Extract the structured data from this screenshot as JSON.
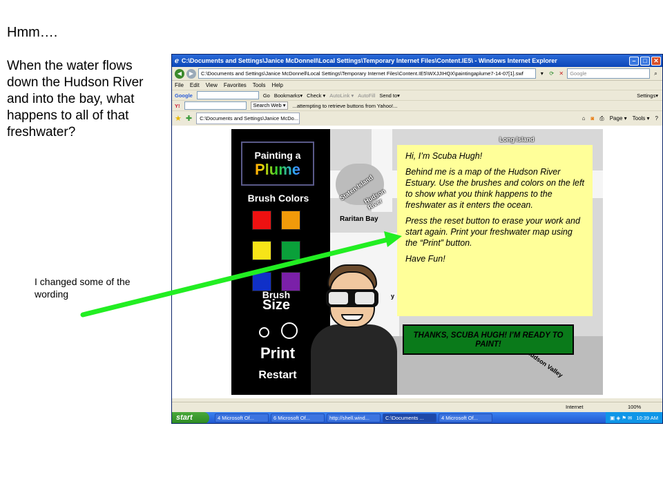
{
  "slide": {
    "title": "Hmm….",
    "question": "When the water flows down the Hudson River and into the bay, what happens to all of that freshwater?",
    "note": "I changed some of the wording"
  },
  "browser": {
    "title": "C:\\Documents and Settings\\Janice McDonnell\\Local Settings\\Temporary Internet Files\\Content.IE5\\ - Windows Internet Explorer",
    "address": "C:\\Documents and Settings\\Janice McDonnell\\Local Settings\\Temporary Internet Files\\Content.IE5\\WXJJIHQX\\paintingaplume7-14-07[1].swf",
    "search_placeholder": "Google",
    "menu": [
      "File",
      "Edit",
      "View",
      "Favorites",
      "Tools",
      "Help"
    ],
    "google_toolbar": {
      "logo": "Google",
      "go": "Go",
      "bookmarks": "Bookmarks▾",
      "check": "Check ▾",
      "autolink": "AutoLink ▾",
      "autofill": "AutoFill",
      "sendto": "Send to▾",
      "settings": "Settings▾"
    },
    "yahoo_toolbar": {
      "logo": "Y!",
      "search_web": "Search Web ▾",
      "status": "...attempting to retrieve buttons from Yahoo!..."
    },
    "tab_label": "C:\\Documents and Settings\\Janice McDo...",
    "tab_tools": {
      "page": "Page ▾",
      "tools": "Tools ▾"
    },
    "status": {
      "zone": "Internet",
      "zoom": "100%"
    }
  },
  "game": {
    "logo_top": "Painting a",
    "logo_bottom": "Plume",
    "brush_colors_label": "Brush Colors",
    "swatches": [
      "#ee1111",
      "#f09a0a",
      "#f7e418",
      "#0aa03a",
      "#1030c8",
      "#7a20a8"
    ],
    "brush_label": "Brush",
    "size_label": "Size",
    "print_label": "Print",
    "restart_label": "Restart",
    "map_labels": {
      "long_island": "Long Island",
      "staten_island": "Staten Island",
      "hudson_river": "Hudson River",
      "raritan_bay": "Raritan Bay",
      "bay_partial": "y",
      "hudson_valley": "Hudson Valley"
    },
    "speech": {
      "greeting": "Hi, I’m Scuba Hugh!",
      "paragraph1": "Behind me is a map of the Hudson River Estuary.  Use the brushes and colors on the left to show what you think happens to the freshwater as it enters the ocean.",
      "paragraph2": "Press the reset button to erase your work and start again.  Print your freshwater map using the “Print” button.",
      "closing": "Have Fun!"
    },
    "ready_button": "THANKS, SCUBA HUGH!  I’M READY TO PAINT!"
  },
  "taskbar": {
    "start": "start",
    "tasks": [
      "4 Microsoft Of...",
      "6 Microsoft Of...",
      "http://shell.wind...",
      "C:\\Documents ...",
      "4 Microsoft Of..."
    ],
    "clock": "10:39 AM"
  },
  "colors": {
    "arrow": "#22ee22",
    "speech_bg": "#ffff99",
    "ready_bg": "#0a7a1a"
  }
}
